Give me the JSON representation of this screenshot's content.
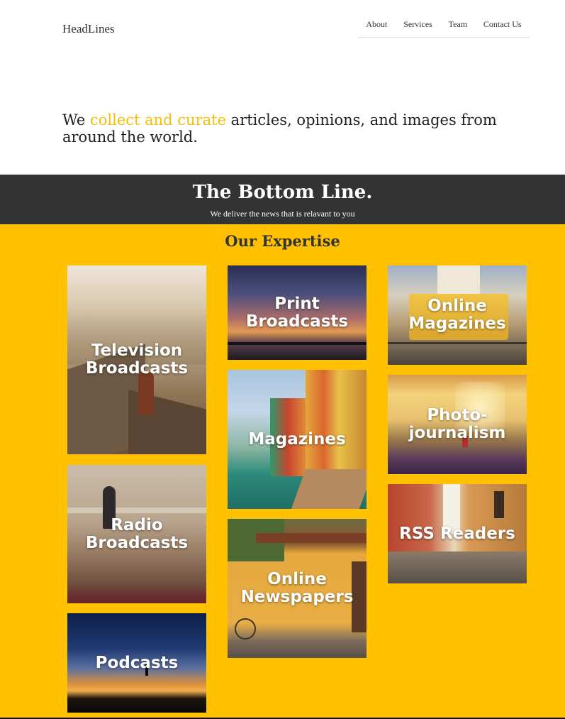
{
  "header": {
    "logo": "HeadLines",
    "nav": [
      "About",
      "Services",
      "Team",
      "Contact Us"
    ]
  },
  "hero": {
    "before": "We ",
    "highlight": "collect and curate",
    "after": " articles, opinions, and images from around the world."
  },
  "band": {
    "title": "The Bottom Line.",
    "subtitle": "We deliver the news that is relavant to you"
  },
  "expertise": {
    "title": "Our Expertise",
    "tiles": [
      "Television Broadcasts",
      "Radio Broadcasts",
      "Podcasts",
      "Print Broadcasts",
      "Magazines",
      "Online Newspapers",
      "Online Magazines",
      "Photo-journalism",
      "RSS Readers"
    ]
  },
  "colors": {
    "accent": "#ffc100",
    "highlight": "#f5c000",
    "band": "#333333"
  }
}
